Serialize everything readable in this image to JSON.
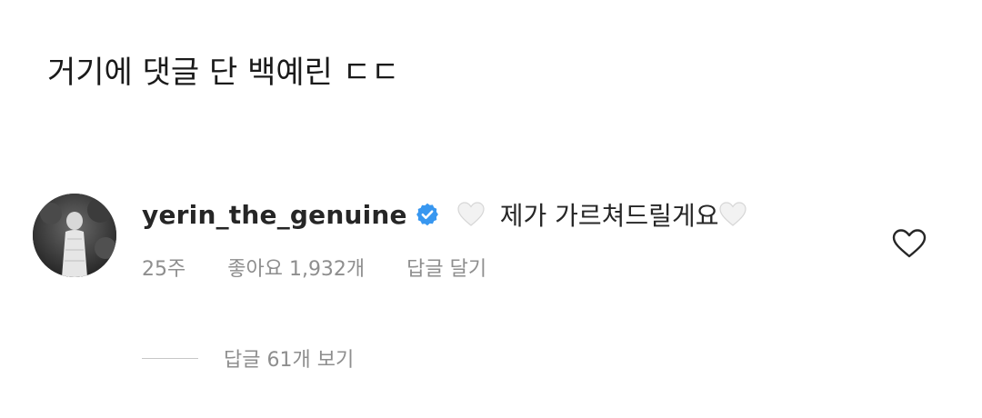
{
  "caption": "거기에 댓글 단 백예린 ㄷㄷ",
  "comment": {
    "username": "yerin_the_genuine",
    "text": "제가 가르쳐드릴게요",
    "time": "25주",
    "likes": "좋아요 1,932개",
    "reply_label": "답글 달기",
    "view_replies": "답글 61개 보기",
    "icons": {
      "verified": "verified-badge-icon",
      "emoji": "white-heart-icon",
      "like": "heart-outline-icon"
    },
    "colors": {
      "verified": "#3897f0",
      "meta": "#8e8e8e",
      "text": "#262626"
    }
  }
}
